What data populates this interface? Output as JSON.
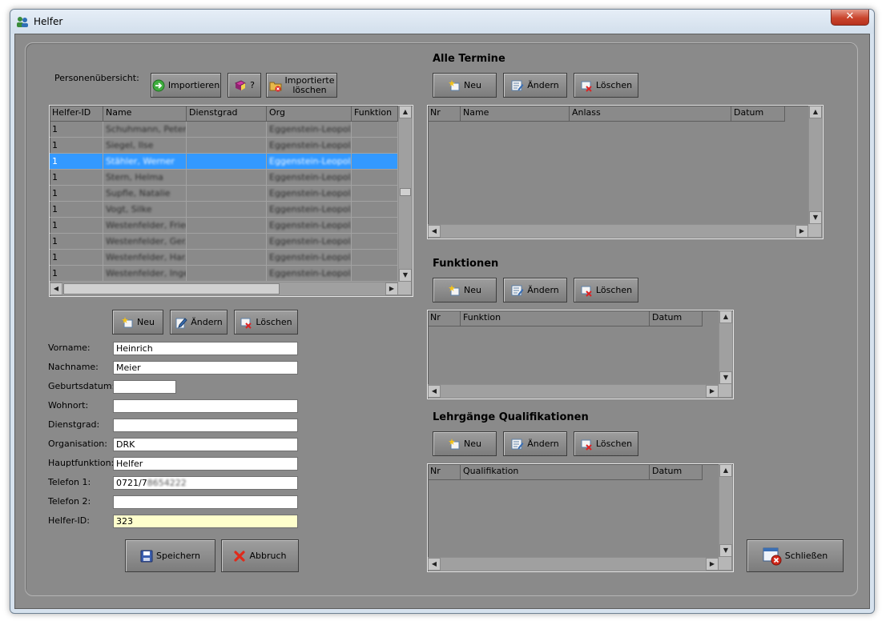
{
  "window": {
    "title": "Helfer",
    "close_label": "✕"
  },
  "persons": {
    "section_label": "Personenübersicht:",
    "buttons": {
      "import": "Importieren",
      "help": "?",
      "delete_imported": "Importierte löschen",
      "delete_imported_l1": "Importierte",
      "delete_imported_l2": "löschen"
    },
    "columns": [
      "Helfer-ID",
      "Name",
      "Dienstgrad",
      "Org",
      "Funktion"
    ],
    "rows": [
      {
        "id": "1",
        "name": "Schuhmann, Peter",
        "dienstgrad": "",
        "org": "Eggenstein-Leopol...",
        "funktion": ""
      },
      {
        "id": "1",
        "name": "Siegel, Ilse",
        "dienstgrad": "",
        "org": "Eggenstein-Leopol...",
        "funktion": ""
      },
      {
        "id": "1",
        "name": "Stähler, Werner",
        "dienstgrad": "",
        "org": "Eggenstein-Leopol...",
        "funktion": ""
      },
      {
        "id": "1",
        "name": "Stern, Helma",
        "dienstgrad": "",
        "org": "Eggenstein-Leopol...",
        "funktion": ""
      },
      {
        "id": "1",
        "name": "Supfle, Natalie",
        "dienstgrad": "",
        "org": "Eggenstein-Leopol...",
        "funktion": ""
      },
      {
        "id": "1",
        "name": "Vogt, Silke",
        "dienstgrad": "",
        "org": "Eggenstein-Leopol...",
        "funktion": ""
      },
      {
        "id": "1",
        "name": "Westenfelder, Frieda",
        "dienstgrad": "",
        "org": "Eggenstein-Leopol...",
        "funktion": ""
      },
      {
        "id": "1",
        "name": "Westenfelder, Ger...",
        "dienstgrad": "",
        "org": "Eggenstein-Leopol...",
        "funktion": ""
      },
      {
        "id": "1",
        "name": "Westenfelder, Har...",
        "dienstgrad": "",
        "org": "Eggenstein-Leopol...",
        "funktion": ""
      },
      {
        "id": "1",
        "name": "Westenfelder, Inge",
        "dienstgrad": "",
        "org": "Eggenstein-Leopol...",
        "funktion": ""
      }
    ],
    "selected_row": 2
  },
  "person_actions": {
    "new": "Neu",
    "edit": "Ändern",
    "delete": "Löschen"
  },
  "form": {
    "vorname": {
      "label": "Vorname:",
      "value": "Heinrich"
    },
    "nachname": {
      "label": "Nachname:",
      "value": "Meier"
    },
    "geburtsdatum": {
      "label": "Geburtsdatum:",
      "value": ""
    },
    "wohnort": {
      "label": "Wohnort:",
      "value": ""
    },
    "dienstgrad": {
      "label": "Dienstgrad:",
      "value": ""
    },
    "organisation": {
      "label": "Organisation:",
      "value": "DRK"
    },
    "hauptfunktion": {
      "label": "Hauptfunktion:",
      "value": "Helfer"
    },
    "telefon1": {
      "label": "Telefon 1:",
      "value": "0721/7",
      "value_hidden": "8654222"
    },
    "telefon2": {
      "label": "Telefon 2:",
      "value": ""
    },
    "helfer_id": {
      "label": "Helfer-ID:",
      "value": "323"
    }
  },
  "form_buttons": {
    "save": "Speichern",
    "cancel": "Abbruch"
  },
  "termine": {
    "title": "Alle Termine",
    "buttons": {
      "new": "Neu",
      "edit": "Ändern",
      "delete": "Löschen"
    },
    "columns": [
      "Nr",
      "Name",
      "Anlass",
      "Datum"
    ]
  },
  "funktionen": {
    "title": "Funktionen",
    "buttons": {
      "new": "Neu",
      "edit": "Ändern",
      "delete": "Löschen"
    },
    "columns": [
      "Nr",
      "Funktion",
      "Datum"
    ]
  },
  "lehrgaenge": {
    "title": "Lehrgänge Qualifikationen",
    "buttons": {
      "new": "Neu",
      "edit": "Ändern",
      "delete": "Löschen"
    },
    "columns": [
      "Nr",
      "Qualifikation",
      "Datum"
    ]
  },
  "close_button": {
    "label": "Schließen"
  }
}
